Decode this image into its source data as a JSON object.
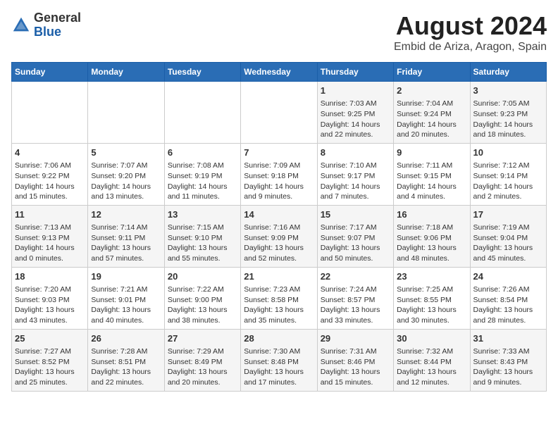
{
  "logo": {
    "general": "General",
    "blue": "Blue"
  },
  "title": "August 2024",
  "subtitle": "Embid de Ariza, Aragon, Spain",
  "headers": [
    "Sunday",
    "Monday",
    "Tuesday",
    "Wednesday",
    "Thursday",
    "Friday",
    "Saturday"
  ],
  "weeks": [
    [
      {
        "day": "",
        "info": ""
      },
      {
        "day": "",
        "info": ""
      },
      {
        "day": "",
        "info": ""
      },
      {
        "day": "",
        "info": ""
      },
      {
        "day": "1",
        "info": "Sunrise: 7:03 AM\nSunset: 9:25 PM\nDaylight: 14 hours and 22 minutes."
      },
      {
        "day": "2",
        "info": "Sunrise: 7:04 AM\nSunset: 9:24 PM\nDaylight: 14 hours and 20 minutes."
      },
      {
        "day": "3",
        "info": "Sunrise: 7:05 AM\nSunset: 9:23 PM\nDaylight: 14 hours and 18 minutes."
      }
    ],
    [
      {
        "day": "4",
        "info": "Sunrise: 7:06 AM\nSunset: 9:22 PM\nDaylight: 14 hours and 15 minutes."
      },
      {
        "day": "5",
        "info": "Sunrise: 7:07 AM\nSunset: 9:20 PM\nDaylight: 14 hours and 13 minutes."
      },
      {
        "day": "6",
        "info": "Sunrise: 7:08 AM\nSunset: 9:19 PM\nDaylight: 14 hours and 11 minutes."
      },
      {
        "day": "7",
        "info": "Sunrise: 7:09 AM\nSunset: 9:18 PM\nDaylight: 14 hours and 9 minutes."
      },
      {
        "day": "8",
        "info": "Sunrise: 7:10 AM\nSunset: 9:17 PM\nDaylight: 14 hours and 7 minutes."
      },
      {
        "day": "9",
        "info": "Sunrise: 7:11 AM\nSunset: 9:15 PM\nDaylight: 14 hours and 4 minutes."
      },
      {
        "day": "10",
        "info": "Sunrise: 7:12 AM\nSunset: 9:14 PM\nDaylight: 14 hours and 2 minutes."
      }
    ],
    [
      {
        "day": "11",
        "info": "Sunrise: 7:13 AM\nSunset: 9:13 PM\nDaylight: 14 hours and 0 minutes."
      },
      {
        "day": "12",
        "info": "Sunrise: 7:14 AM\nSunset: 9:11 PM\nDaylight: 13 hours and 57 minutes."
      },
      {
        "day": "13",
        "info": "Sunrise: 7:15 AM\nSunset: 9:10 PM\nDaylight: 13 hours and 55 minutes."
      },
      {
        "day": "14",
        "info": "Sunrise: 7:16 AM\nSunset: 9:09 PM\nDaylight: 13 hours and 52 minutes."
      },
      {
        "day": "15",
        "info": "Sunrise: 7:17 AM\nSunset: 9:07 PM\nDaylight: 13 hours and 50 minutes."
      },
      {
        "day": "16",
        "info": "Sunrise: 7:18 AM\nSunset: 9:06 PM\nDaylight: 13 hours and 48 minutes."
      },
      {
        "day": "17",
        "info": "Sunrise: 7:19 AM\nSunset: 9:04 PM\nDaylight: 13 hours and 45 minutes."
      }
    ],
    [
      {
        "day": "18",
        "info": "Sunrise: 7:20 AM\nSunset: 9:03 PM\nDaylight: 13 hours and 43 minutes."
      },
      {
        "day": "19",
        "info": "Sunrise: 7:21 AM\nSunset: 9:01 PM\nDaylight: 13 hours and 40 minutes."
      },
      {
        "day": "20",
        "info": "Sunrise: 7:22 AM\nSunset: 9:00 PM\nDaylight: 13 hours and 38 minutes."
      },
      {
        "day": "21",
        "info": "Sunrise: 7:23 AM\nSunset: 8:58 PM\nDaylight: 13 hours and 35 minutes."
      },
      {
        "day": "22",
        "info": "Sunrise: 7:24 AM\nSunset: 8:57 PM\nDaylight: 13 hours and 33 minutes."
      },
      {
        "day": "23",
        "info": "Sunrise: 7:25 AM\nSunset: 8:55 PM\nDaylight: 13 hours and 30 minutes."
      },
      {
        "day": "24",
        "info": "Sunrise: 7:26 AM\nSunset: 8:54 PM\nDaylight: 13 hours and 28 minutes."
      }
    ],
    [
      {
        "day": "25",
        "info": "Sunrise: 7:27 AM\nSunset: 8:52 PM\nDaylight: 13 hours and 25 minutes."
      },
      {
        "day": "26",
        "info": "Sunrise: 7:28 AM\nSunset: 8:51 PM\nDaylight: 13 hours and 22 minutes."
      },
      {
        "day": "27",
        "info": "Sunrise: 7:29 AM\nSunset: 8:49 PM\nDaylight: 13 hours and 20 minutes."
      },
      {
        "day": "28",
        "info": "Sunrise: 7:30 AM\nSunset: 8:48 PM\nDaylight: 13 hours and 17 minutes."
      },
      {
        "day": "29",
        "info": "Sunrise: 7:31 AM\nSunset: 8:46 PM\nDaylight: 13 hours and 15 minutes."
      },
      {
        "day": "30",
        "info": "Sunrise: 7:32 AM\nSunset: 8:44 PM\nDaylight: 13 hours and 12 minutes."
      },
      {
        "day": "31",
        "info": "Sunrise: 7:33 AM\nSunset: 8:43 PM\nDaylight: 13 hours and 9 minutes."
      }
    ]
  ]
}
